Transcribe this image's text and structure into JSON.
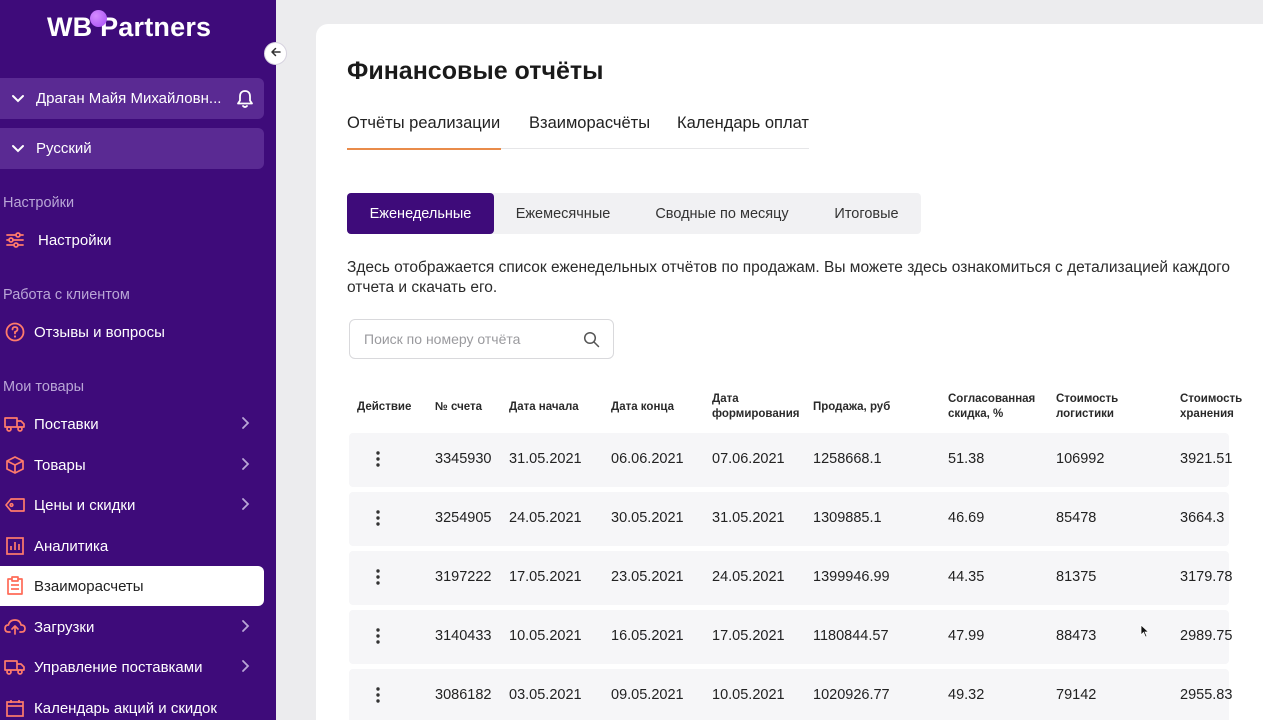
{
  "brand": {
    "logo_text": "WB Partners"
  },
  "user": {
    "name": "Драган Майя Михайловн..."
  },
  "language": {
    "label": "Русский"
  },
  "sidebar": {
    "sections": [
      {
        "label": "Настройки"
      },
      {
        "label": "Работа с клиентом"
      },
      {
        "label": "Мои товары"
      }
    ],
    "settings_item": "Настройки",
    "reviews_item": "Отзывы и вопросы",
    "items": [
      {
        "label": "Поставки",
        "has_arrow": true
      },
      {
        "label": "Товары",
        "has_arrow": true
      },
      {
        "label": "Цены и скидки",
        "has_arrow": true
      },
      {
        "label": "Аналитика",
        "has_arrow": false
      },
      {
        "label": "Взаиморасчеты",
        "has_arrow": false,
        "active": true
      },
      {
        "label": "Загрузки",
        "has_arrow": true
      },
      {
        "label": "Управление поставками",
        "has_arrow": true
      },
      {
        "label": "Календарь акций и скидок",
        "has_arrow": false
      }
    ]
  },
  "page": {
    "title": "Финансовые отчёты",
    "tabs": [
      {
        "label": "Отчёты реализации",
        "active": true
      },
      {
        "label": "Взаиморасчёты",
        "active": false
      },
      {
        "label": "Календарь оплат",
        "active": false
      }
    ],
    "segments": [
      {
        "label": "Еженедельные",
        "active": true
      },
      {
        "label": "Ежемесячные",
        "active": false
      },
      {
        "label": "Сводные по месяцу",
        "active": false
      },
      {
        "label": "Итоговые",
        "active": false
      }
    ],
    "description": "Здесь отображается список еженедельных отчётов по продажам. Вы можете здесь ознакомиться с детализацией каждого отчета и скачать его.",
    "search_placeholder": "Поиск по номеру отчёта"
  },
  "table": {
    "headers": [
      "Действие",
      "№ счета",
      "Дата начала",
      "Дата конца",
      "Дата формирования",
      "Продажа, руб",
      "Согласованная скидка, %",
      "Стоимость логистики",
      "Стоимость хранения"
    ],
    "rows": [
      [
        "3345930",
        "31.05.2021",
        "06.06.2021",
        "07.06.2021",
        "1258668.1",
        "51.38",
        "106992",
        "3921.51"
      ],
      [
        "3254905",
        "24.05.2021",
        "30.05.2021",
        "31.05.2021",
        "1309885.1",
        "46.69",
        "85478",
        "3664.3"
      ],
      [
        "3197222",
        "17.05.2021",
        "23.05.2021",
        "24.05.2021",
        "1399946.99",
        "44.35",
        "81375",
        "3179.78"
      ],
      [
        "3140433",
        "10.05.2021",
        "16.05.2021",
        "17.05.2021",
        "1180844.57",
        "47.99",
        "88473",
        "2989.75"
      ],
      [
        "3086182",
        "03.05.2021",
        "09.05.2021",
        "10.05.2021",
        "1020926.77",
        "49.32",
        "79142",
        "2955.83"
      ]
    ]
  },
  "colors": {
    "sidebar_bg": "#3e0b7a",
    "accent_orange": "#e98b4a",
    "active_segment": "#3e0b7a"
  }
}
